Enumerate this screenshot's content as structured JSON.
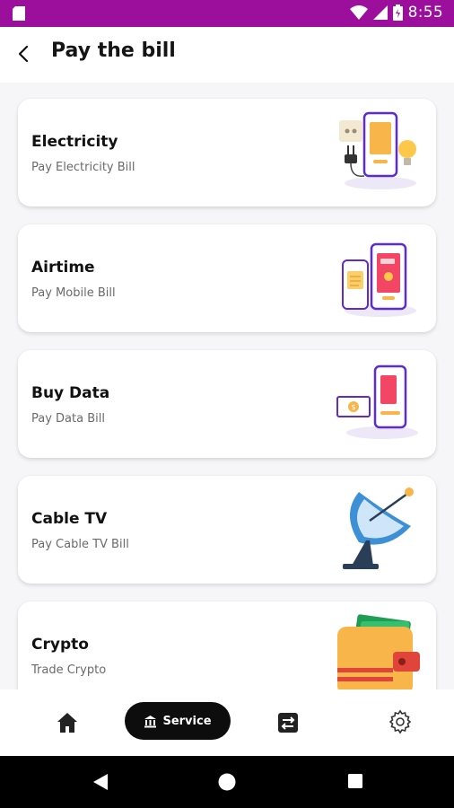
{
  "status_bar": {
    "time": "8:55",
    "icons": [
      "sim-card-icon",
      "wifi-icon",
      "signal-icon",
      "battery-icon"
    ]
  },
  "header": {
    "back_icon": "arrow-left-icon",
    "title": "Pay the bill"
  },
  "services": [
    {
      "title": "Electricity",
      "subtitle": "Pay Electricity Bill",
      "illustration": "electricity-illustration"
    },
    {
      "title": "Airtime",
      "subtitle": "Pay Mobile Bill",
      "illustration": "airtime-illustration"
    },
    {
      "title": "Buy Data",
      "subtitle": "Pay Data Bill",
      "illustration": "data-illustration"
    },
    {
      "title": "Cable TV",
      "subtitle": "Pay Cable TV Bill",
      "illustration": "satellite-dish-illustration"
    },
    {
      "title": "Crypto",
      "subtitle": "Trade Crypto",
      "illustration": "wallet-illustration"
    }
  ],
  "bottom_nav": {
    "items": [
      {
        "icon": "home-icon"
      },
      {
        "icon": "bank-icon",
        "label": "Service",
        "active": true
      },
      {
        "icon": "transfer-icon"
      },
      {
        "icon": "gear-icon"
      }
    ]
  },
  "system_nav": [
    "back-triangle-icon",
    "home-circle-icon",
    "recents-square-icon"
  ],
  "colors": {
    "status_bar": "#9c0f9c",
    "accent_purple": "#6c2bd9",
    "accent_orange": "#f6b23a",
    "active_pill": "#0d0d0d"
  }
}
